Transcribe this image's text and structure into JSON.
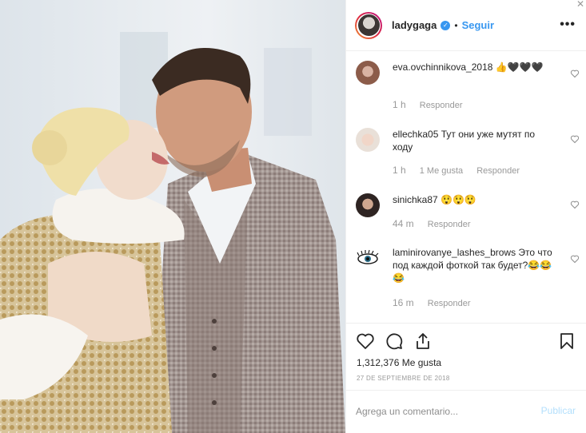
{
  "post": {
    "image_alt": "ladygaga post photo",
    "username": "ladygaga",
    "follow_label": "Seguir",
    "separator": "•",
    "more_icon": "ellipsis-icon",
    "likes": "1,312,376 Me gusta",
    "date": "27 DE SEPTIEMBRE DE 2018"
  },
  "comments": [
    {
      "user": "eva.ovchinnikova_2018",
      "text": "👍🖤🖤🖤",
      "time": "1 h",
      "likes": "",
      "reply": "Responder"
    },
    {
      "user": "ellechka05",
      "text": "Тут они уже мутят по ходу",
      "time": "1 h",
      "likes": "1 Me gusta",
      "reply": "Responder"
    },
    {
      "user": "sinichka87",
      "text": "😲😲😲",
      "time": "44 m",
      "likes": "",
      "reply": "Responder"
    },
    {
      "user": "laminirovanye_lashes_brows",
      "text": "Это что под каждой фоткой так будет?😂😂😂",
      "time": "16 m",
      "likes": "",
      "reply": "Responder"
    }
  ],
  "composer": {
    "placeholder": "Agrega un comentario...",
    "publish": "Publicar"
  },
  "colors": {
    "link": "#3897f0",
    "muted": "#999999",
    "publish_disabled": "#b2dffc"
  }
}
